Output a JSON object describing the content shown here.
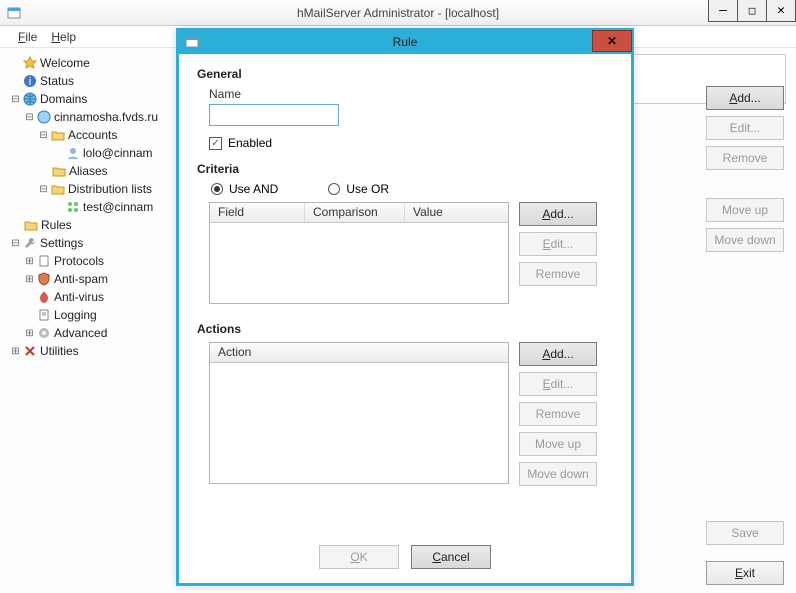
{
  "main": {
    "title": "hMailServer Administrator - [localhost]",
    "winbtns": {
      "min": "—",
      "max": "□",
      "close": "✕"
    }
  },
  "menubar": {
    "file": "File",
    "help": "Help"
  },
  "tree": {
    "welcome": "Welcome",
    "status": "Status",
    "domains": "Domains",
    "domain": "cinnamosha.fvds.ru",
    "accounts": "Accounts",
    "account1": "lolo@cinnam",
    "aliases": "Aliases",
    "distlists": "Distribution lists",
    "dist1": "test@cinnam",
    "rules": "Rules",
    "settings": "Settings",
    "protocols": "Protocols",
    "antispam": "Anti-spam",
    "antivirus": "Anti-virus",
    "logging": "Logging",
    "advanced": "Advanced",
    "utilities": "Utilities"
  },
  "right": {
    "add": "Add...",
    "edit": "Edit...",
    "remove": "Remove",
    "moveup": "Move up",
    "movedown": "Move down",
    "save": "Save",
    "exit": "Exit"
  },
  "dialog": {
    "title": "Rule",
    "general": "General",
    "name_label": "Name",
    "name_value": "",
    "enabled": "Enabled",
    "criteria": "Criteria",
    "use_and": "Use AND",
    "use_or": "Use OR",
    "col_field": "Field",
    "col_comparison": "Comparison",
    "col_value": "Value",
    "actions": "Actions",
    "col_action": "Action",
    "btn_add": "Add...",
    "btn_edit": "Edit...",
    "btn_remove": "Remove",
    "btn_moveup": "Move up",
    "btn_movedown": "Move down",
    "btn_ok": "OK",
    "btn_cancel": "Cancel"
  }
}
